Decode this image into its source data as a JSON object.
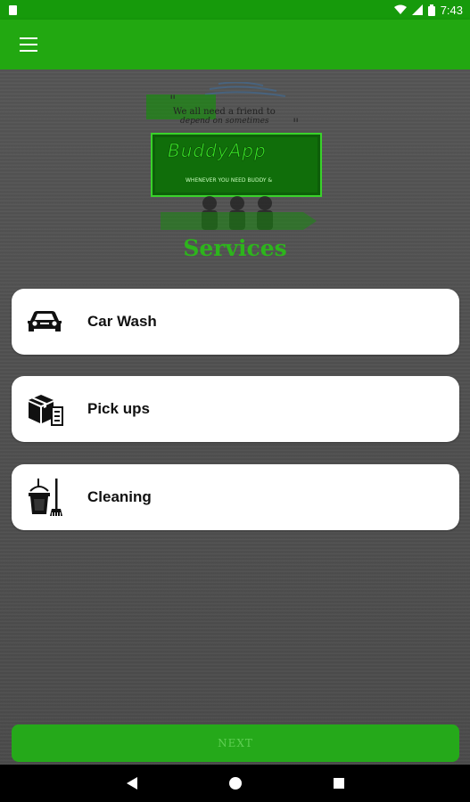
{
  "status_bar": {
    "time": "7:43",
    "icons": [
      "notification-icon",
      "wifi-icon",
      "cellular-icon",
      "battery-icon"
    ]
  },
  "app_bar": {
    "menu_icon": "hamburger-menu-icon"
  },
  "logo": {
    "quote_line1": "We all need a friend to",
    "quote_line2": "depend on sometimes",
    "brand": "BuddyApp",
    "tagline": "WHENEVER YOU NEED BUDDY & ",
    "logo_icon": "people-group-icon"
  },
  "page": {
    "title": "Services"
  },
  "services": [
    {
      "label": "Car Wash",
      "icon": "car-icon"
    },
    {
      "label": "Pick ups",
      "icon": "boxes-icon"
    },
    {
      "label": "Cleaning",
      "icon": "bucket-mop-icon"
    }
  ],
  "footer": {
    "next_label": "NEXT"
  },
  "nav_bar": {
    "icons": [
      "back-icon",
      "home-icon",
      "recents-icon"
    ]
  },
  "colors": {
    "status_bar": "#169a0b",
    "app_bar": "#22a811",
    "accent_text": "#2db51c",
    "background": "#4f4f4f",
    "next_button": "#25a91a"
  }
}
